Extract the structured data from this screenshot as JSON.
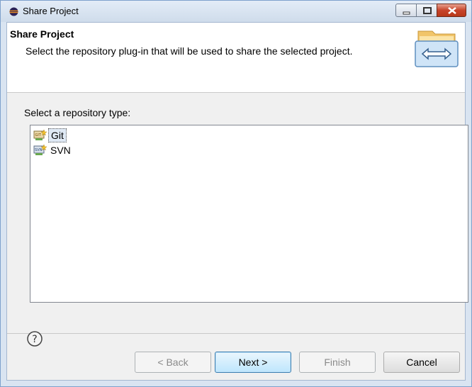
{
  "window": {
    "title": "Share Project"
  },
  "header": {
    "title": "Share Project",
    "description": "Select the repository plug-in that will be used to share the selected project."
  },
  "main": {
    "prompt": "Select a repository type:",
    "repositories": [
      {
        "label": "Git",
        "icon": "git-repository-icon",
        "selected": true
      },
      {
        "label": "SVN",
        "icon": "svn-repository-icon",
        "selected": false
      }
    ]
  },
  "buttons": {
    "back": "< Back",
    "next": "Next >",
    "finish": "Finish",
    "cancel": "Cancel"
  },
  "icons": {
    "help": "help-icon",
    "app": "eclipse-icon",
    "wizard_banner": "share-project-banner-icon"
  },
  "colors": {
    "title_bar": "#cfdceb",
    "close_button": "#c7442a",
    "default_button_border": "#3c7fb1",
    "selection": "#dfe9f5"
  }
}
